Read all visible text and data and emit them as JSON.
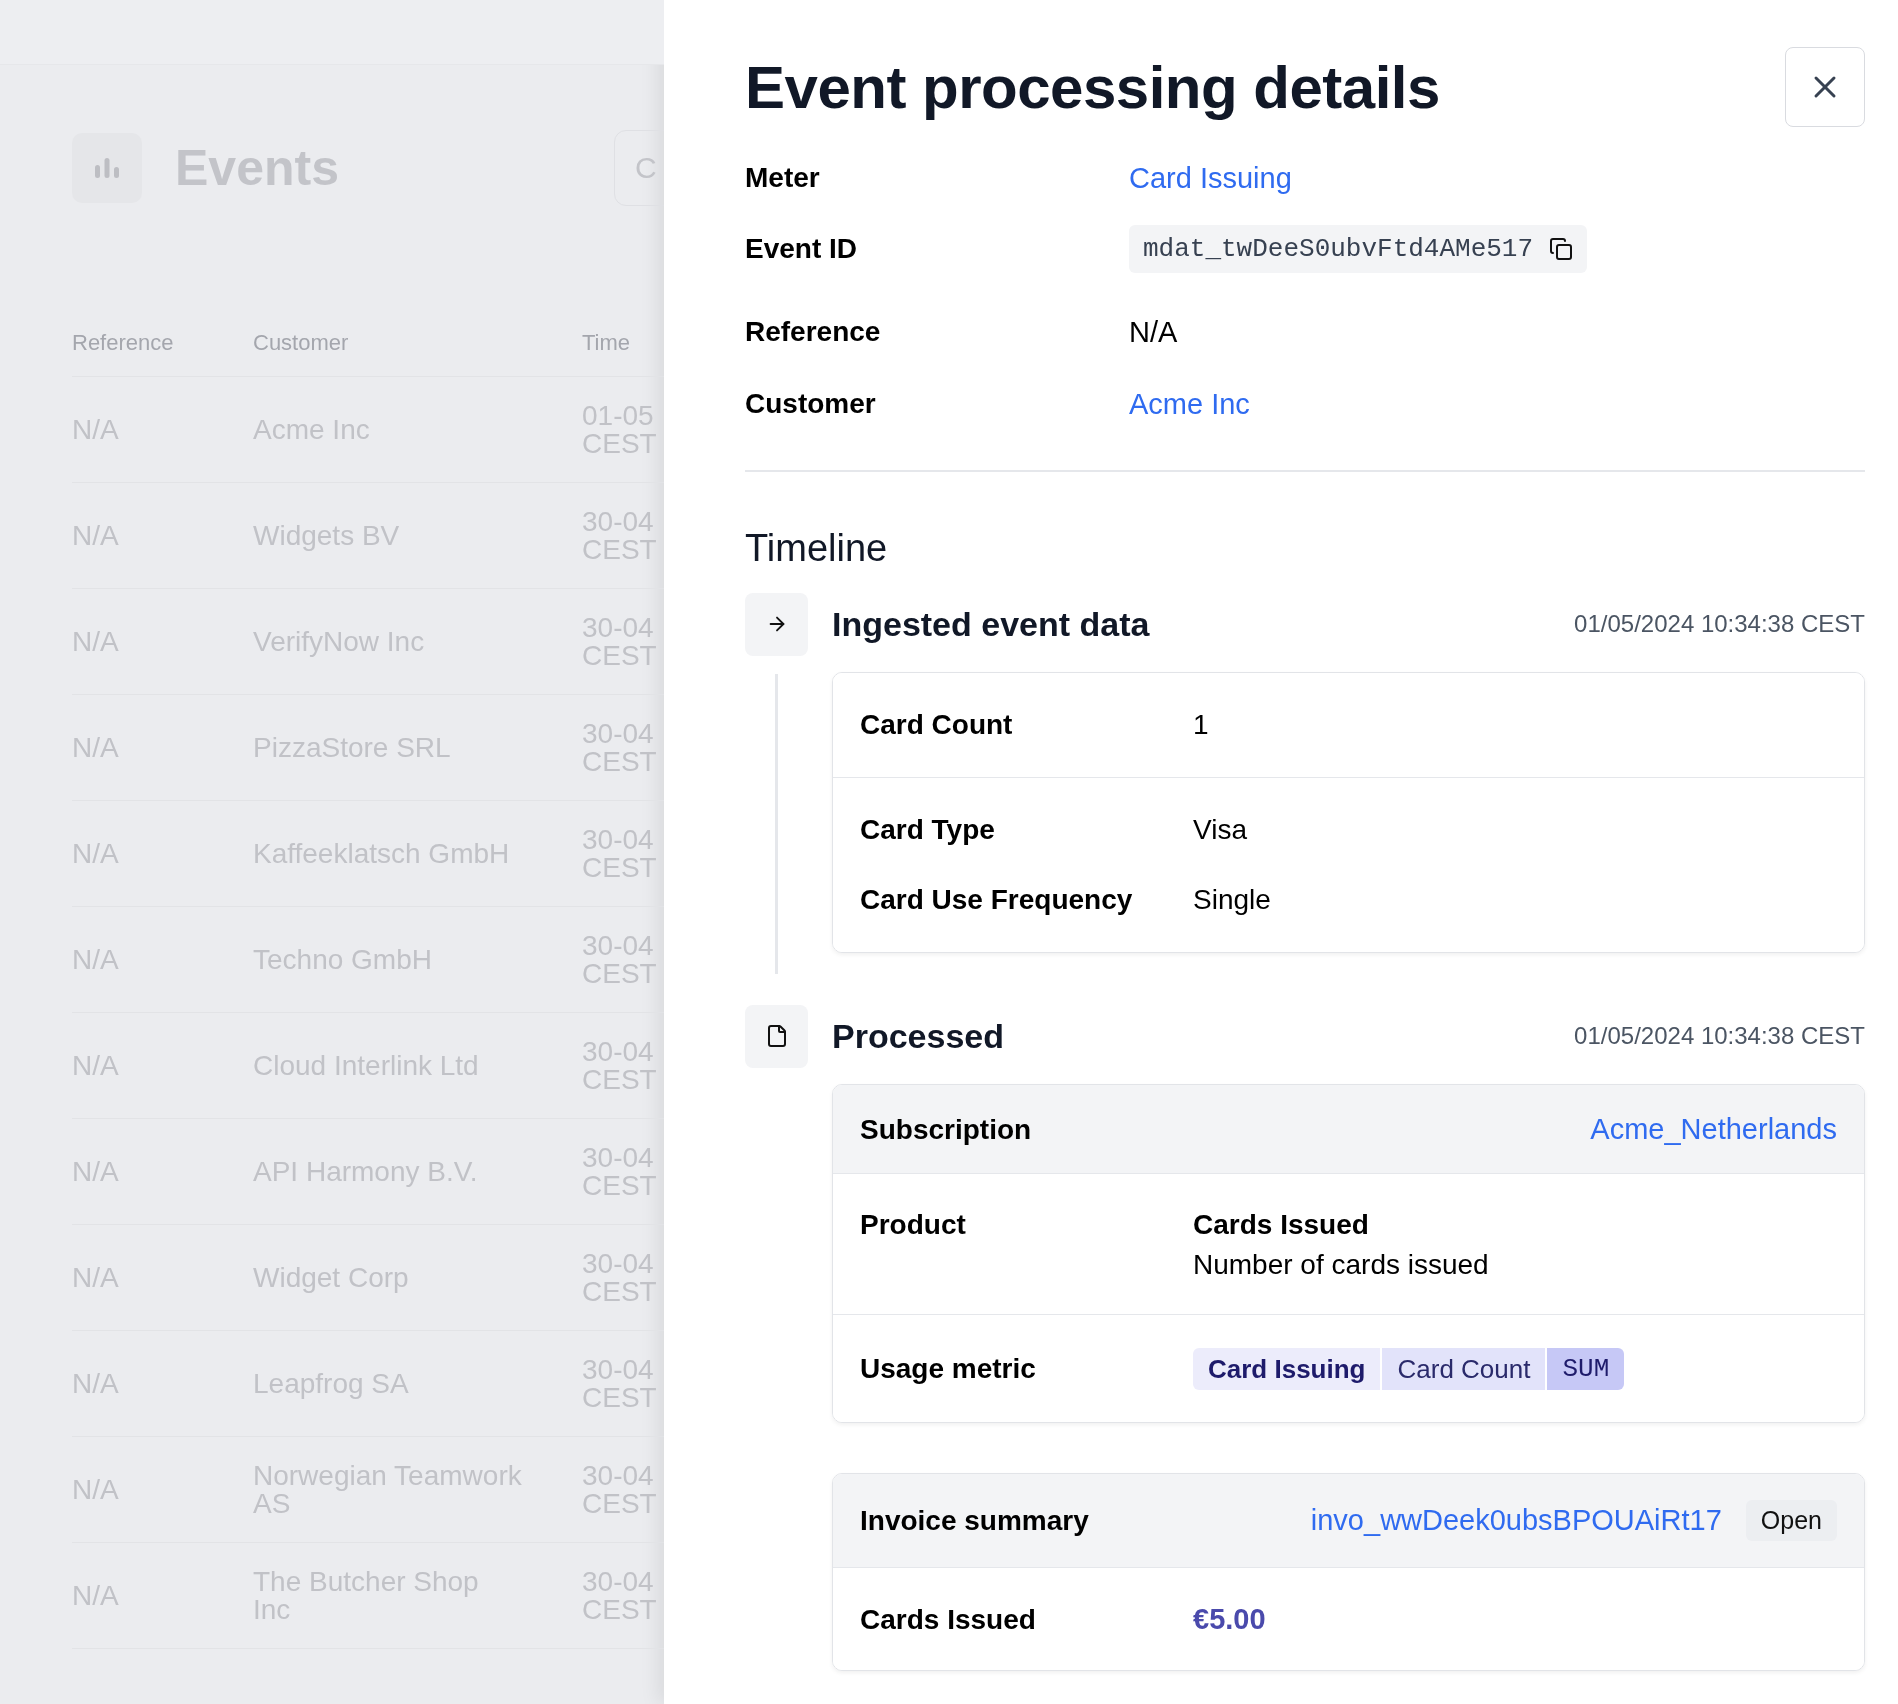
{
  "background_page": {
    "title": "Events",
    "search_button": "C",
    "table": {
      "columns": [
        "Reference",
        "Customer",
        "Time"
      ],
      "rows": [
        {
          "reference": "N/A",
          "customer": "Acme Inc",
          "time": "01-05",
          "zone": "CEST"
        },
        {
          "reference": "N/A",
          "customer": "Widgets BV",
          "time": "30-04",
          "zone": "CEST"
        },
        {
          "reference": "N/A",
          "customer": "VerifyNow Inc",
          "time": "30-04",
          "zone": "CEST"
        },
        {
          "reference": "N/A",
          "customer": "PizzaStore SRL",
          "time": "30-04",
          "zone": "CEST"
        },
        {
          "reference": "N/A",
          "customer": "Kaffeeklatsch GmbH",
          "time": "30-04",
          "zone": "CEST"
        },
        {
          "reference": "N/A",
          "customer": "Techno GmbH",
          "time": "30-04",
          "zone": "CEST"
        },
        {
          "reference": "N/A",
          "customer": "Cloud Interlink Ltd",
          "time": "30-04",
          "zone": "CEST"
        },
        {
          "reference": "N/A",
          "customer": "API Harmony B.V.",
          "time": "30-04",
          "zone": "CEST"
        },
        {
          "reference": "N/A",
          "customer": "Widget Corp",
          "time": "30-04",
          "zone": "CEST"
        },
        {
          "reference": "N/A",
          "customer": "Leapfrog SA",
          "time": "30-04",
          "zone": "CEST"
        },
        {
          "reference": "N/A",
          "customer": "Norwegian Teamwork AS",
          "time": "30-04",
          "zone": "CEST"
        },
        {
          "reference": "N/A",
          "customer": "The Butcher Shop Inc",
          "time": "30-04",
          "zone": "CEST"
        }
      ]
    }
  },
  "panel": {
    "title": "Event processing details",
    "details": [
      {
        "label": "Meter",
        "value": "Card Issuing",
        "kind": "link"
      },
      {
        "label": "Event ID",
        "value": "mdat_twDeeS0ubvFtd4AMe517",
        "kind": "code"
      },
      {
        "label": "Reference",
        "value": "N/A",
        "kind": "text"
      },
      {
        "label": "Customer",
        "value": "Acme Inc",
        "kind": "link"
      }
    ],
    "timeline": {
      "heading": "Timeline",
      "entries": [
        {
          "kind": "ingested",
          "title": "Ingested event data",
          "time": "01/05/2024 10:34:38 CEST",
          "field_groups": [
            [
              {
                "label": "Card Count",
                "value": "1"
              }
            ],
            [
              {
                "label": "Card Type",
                "value": "Visa"
              },
              {
                "label": "Card Use Frequency",
                "value": "Single"
              }
            ]
          ]
        },
        {
          "kind": "processed",
          "title": "Processed",
          "time": "01/05/2024 10:34:38 CEST",
          "subscription": {
            "label": "Subscription",
            "value": "Acme_Netherlands"
          },
          "product": {
            "label": "Product",
            "name": "Cards Issued",
            "description": "Number of cards issued"
          },
          "usage_metric": {
            "label": "Usage metric",
            "tags": [
              {
                "text": "Card Issuing",
                "kind": "meter"
              },
              {
                "text": "Card Count",
                "kind": "field"
              },
              {
                "text": "SUM",
                "kind": "aggregation"
              }
            ]
          }
        }
      ]
    },
    "invoice_summary": {
      "label": "Invoice summary",
      "invoice_id": "invo_wwDeek0ubsBPOUAiRt17",
      "status": "Open",
      "lines": [
        {
          "label": "Cards Issued",
          "amount": "€5.00"
        }
      ]
    }
  }
}
